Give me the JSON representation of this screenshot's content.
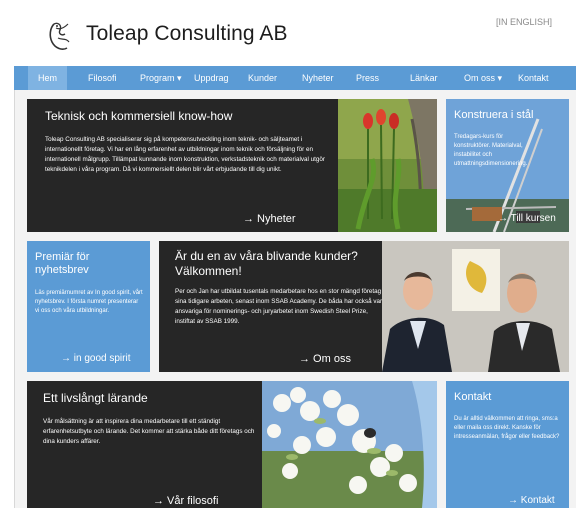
{
  "header": {
    "brand": "Toleap Consulting AB",
    "language_link": "[IN ENGLISH]"
  },
  "nav": {
    "items": [
      {
        "label": "Hem"
      },
      {
        "label": "Filosofi"
      },
      {
        "label": "Program ▾"
      },
      {
        "label": "Uppdrag"
      },
      {
        "label": "Kunder"
      },
      {
        "label": "Nyheter"
      },
      {
        "label": "Press"
      },
      {
        "label": "Länkar"
      },
      {
        "label": "Om oss ▾"
      },
      {
        "label": "Kontakt"
      }
    ]
  },
  "panels": {
    "knowhow": {
      "title": "Teknisk och kommersiell know-how",
      "text": "Toleap Consulting AB specialiserar sig på kompetensutveckling inom teknik- och säljteamet i internationellt företag. Vi har en lång erfarenhet av utbildningar inom teknik och försäljning för en internationell målgrupp. Tillämpat kunnande inom konstruktion, verkstadsteknik och materialval utgör teknikdelen i våra program. Då vi kommersiellt delen blir vårt erbjudande till dig unikt.",
      "link": "→ Nyheter"
    },
    "steel": {
      "title": "Konstruera i stål",
      "text": "Tredagars-kurs för konstruktörer. Materialval, instabilitet och utmattningsdimensionering.",
      "link": "→ Till kursen"
    },
    "newsletter": {
      "title": "Premiär för nyhetsbrev",
      "text": "Läs premiärnumret av In good spirit, vårt nyhetsbrev. I första numret presenterar vi oss och våra utbildningar.",
      "link": "→ in good spirit"
    },
    "customers": {
      "title": "Är du en av våra blivande kunder? Välkommen!",
      "text": "Per och Jan har utbildat tusentals medarbetare hos en stor mängd företag i sina tidigare arbeten, senast inom SSAB Academy. De båda har också varit ansvariga för nominerings- och juryarbetet inom Swedish Steel Prize, instiftat av SSAB 1999.",
      "link": "→ Om oss"
    },
    "learning": {
      "title": "Ett livslångt lärande",
      "text": "Vår målsättning är att inspirera dina medarbetare till ett ständigt erfarenhetsutbyte och lärande. Det kommer att stärka både ditt företags och dina kunders affärer.",
      "link": "→ Vår filosofi"
    },
    "contact": {
      "title": "Kontakt",
      "text": "Du är alltid välkommen att ringa, sms:a eller maila oss direkt. Kanske för intresseanmälan, frågor eller feedback?",
      "link": "→ Kontakt"
    }
  },
  "colors": {
    "nav_blue": "#5b9bd5",
    "panel_dark": "#262626",
    "panel_blue": "#5b9bd5"
  },
  "icons": {
    "logo": "logo-bird-icon"
  }
}
